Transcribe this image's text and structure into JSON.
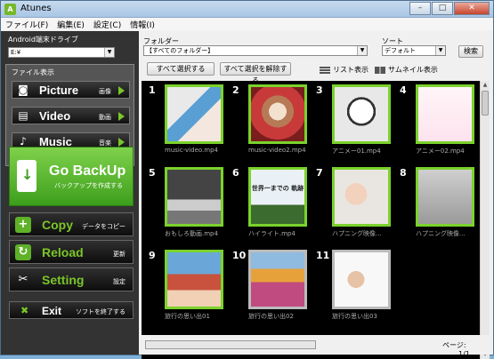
{
  "window": {
    "title": "Atunes",
    "icon": "app-icon",
    "buttons": {
      "min": "–",
      "max": "□",
      "close": "✕"
    }
  },
  "menu": [
    "ファイル(F)",
    "編集(E)",
    "設定(C)",
    "情報(I)"
  ],
  "left": {
    "drive_label": "Android端末ドライブ",
    "drive_value": "E:¥",
    "file_view_label": "ファイル表示",
    "file_buttons": [
      {
        "label": "Picture",
        "sub": "画像",
        "icon": "camera-icon"
      },
      {
        "label": "Video",
        "sub": "動画",
        "icon": "film-icon"
      },
      {
        "label": "Music",
        "sub": "音楽",
        "icon": "music-note-icon"
      }
    ],
    "backup": {
      "label": "Go BackUp",
      "sub": "バックアップを作成する",
      "icon": "phone-download-icon"
    },
    "actions": [
      {
        "label": "Copy",
        "sub": "データをコピー",
        "icon": "copy-icon"
      },
      {
        "label": "Reload",
        "sub": "更新",
        "icon": "reload-icon"
      },
      {
        "label": "Setting",
        "sub": "設定",
        "icon": "tools-icon"
      }
    ],
    "exit": {
      "label": "Exit",
      "sub": "ソフトを終了する",
      "icon": "x-icon"
    }
  },
  "right": {
    "folder_label": "フォルダー",
    "folder_value": "【すべてのフォルダー】",
    "sort_label": "ソート",
    "sort_value": "デフォルト",
    "search_label": "検索",
    "select_all": "すべて選択する",
    "deselect_all": "すべて選択を解除する",
    "list_view": "リスト表示",
    "thumb_view": "サムネイル表示",
    "items": [
      {
        "num": "1",
        "name": "music-video.mp4",
        "selected": true
      },
      {
        "num": "2",
        "name": "music-video2.mp4",
        "selected": true
      },
      {
        "num": "3",
        "name": "アニメー01.mp4",
        "selected": true
      },
      {
        "num": "4",
        "name": "アニメー02.mp4",
        "selected": true
      },
      {
        "num": "5",
        "name": "おもしろ動画.mp4",
        "selected": true
      },
      {
        "num": "6",
        "name": "ハイライト.mp4",
        "selected": true
      },
      {
        "num": "7",
        "name": "ハプニング映像...",
        "selected": true
      },
      {
        "num": "8",
        "name": "ハプニング映像...",
        "selected": true
      },
      {
        "num": "9",
        "name": "旅行の思い出01",
        "selected": true
      },
      {
        "num": "10",
        "name": "旅行の思い出02",
        "selected": false
      },
      {
        "num": "11",
        "name": "旅行の思い出03",
        "selected": false
      }
    ],
    "thumb6_text": "世界一までの 軌跡",
    "progress": 0,
    "page_label": "ページ:",
    "page_value": "1/1"
  }
}
